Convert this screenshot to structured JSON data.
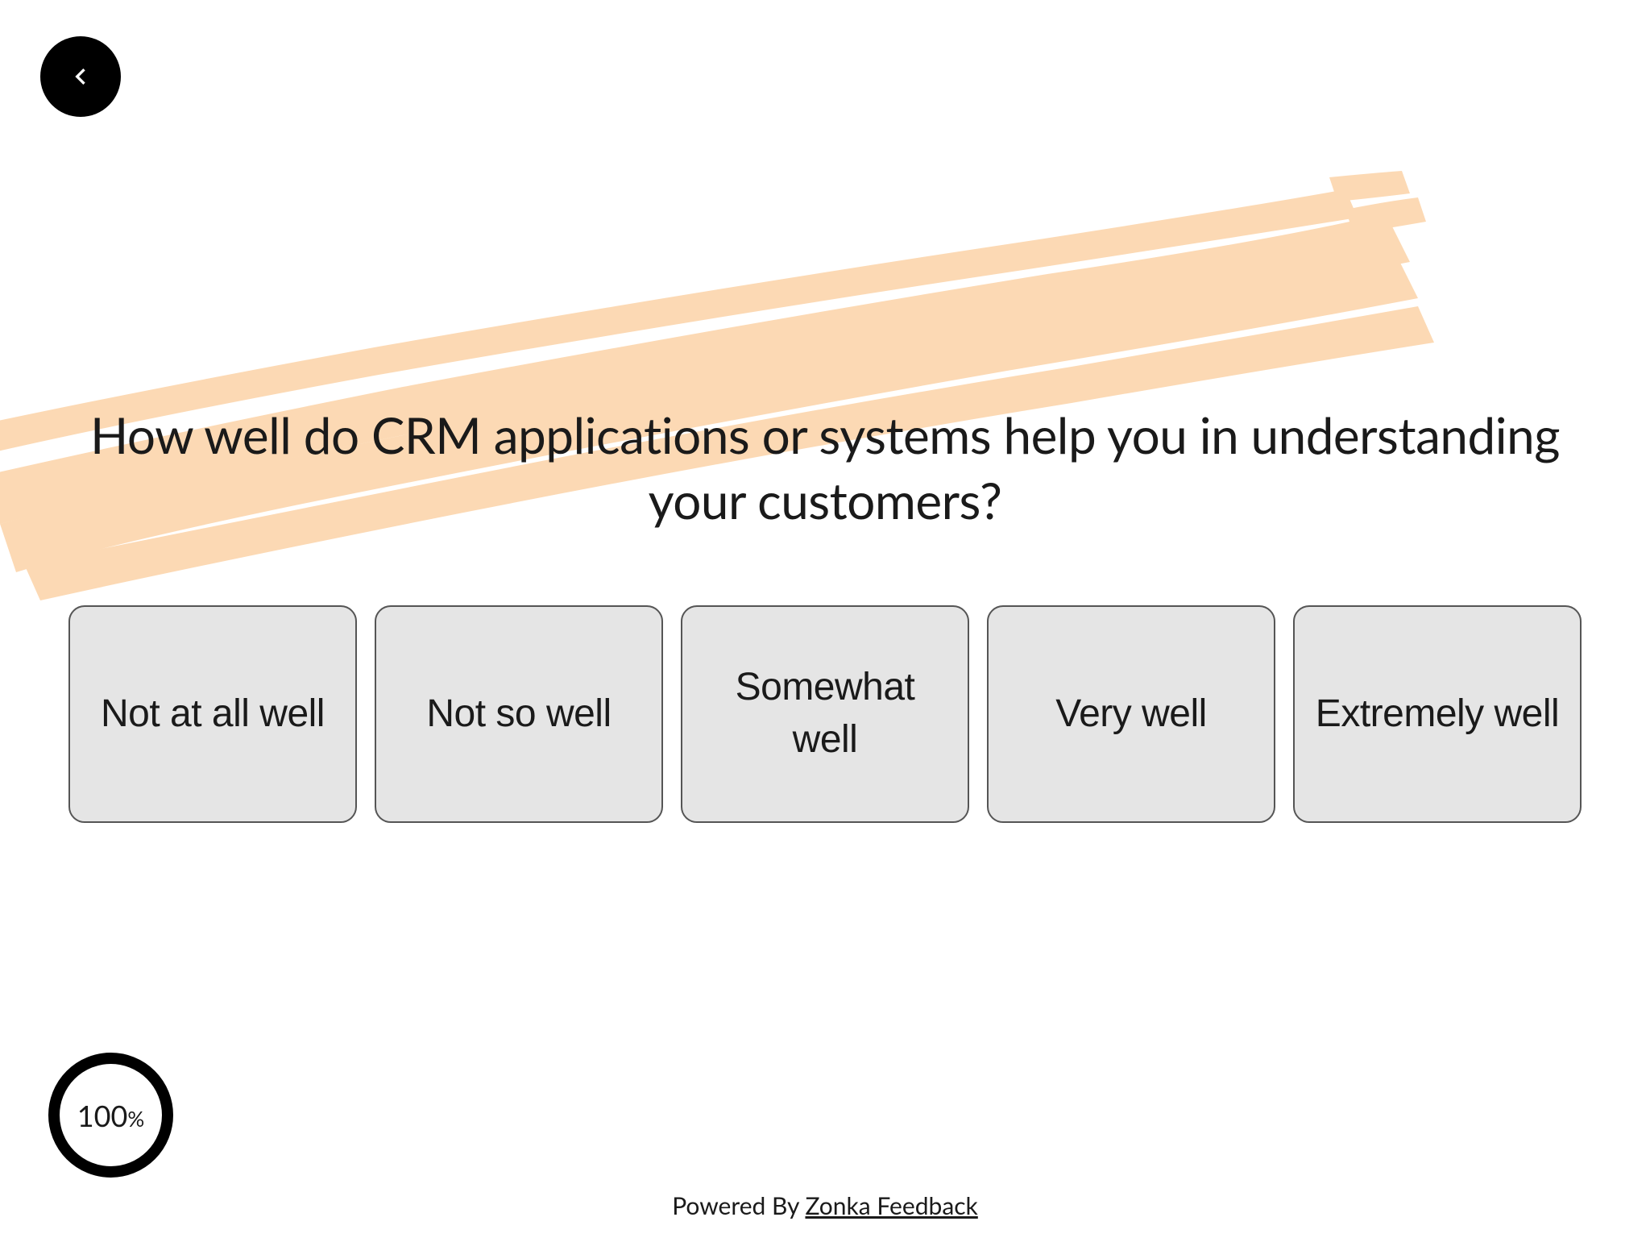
{
  "question": {
    "text": "How well do CRM applications or systems help you in understanding your customers?",
    "options": [
      "Not at all well",
      "Not so well",
      "Somewhat well",
      "Very well",
      "Extremely well"
    ]
  },
  "progress": {
    "value": "100",
    "percent_symbol": "%"
  },
  "footer": {
    "prefix": "Powered By ",
    "link_text": "Zonka Feedback"
  },
  "colors": {
    "brush": "#fcd8b0",
    "option_bg": "#e5e5e5",
    "option_border": "#555555"
  }
}
